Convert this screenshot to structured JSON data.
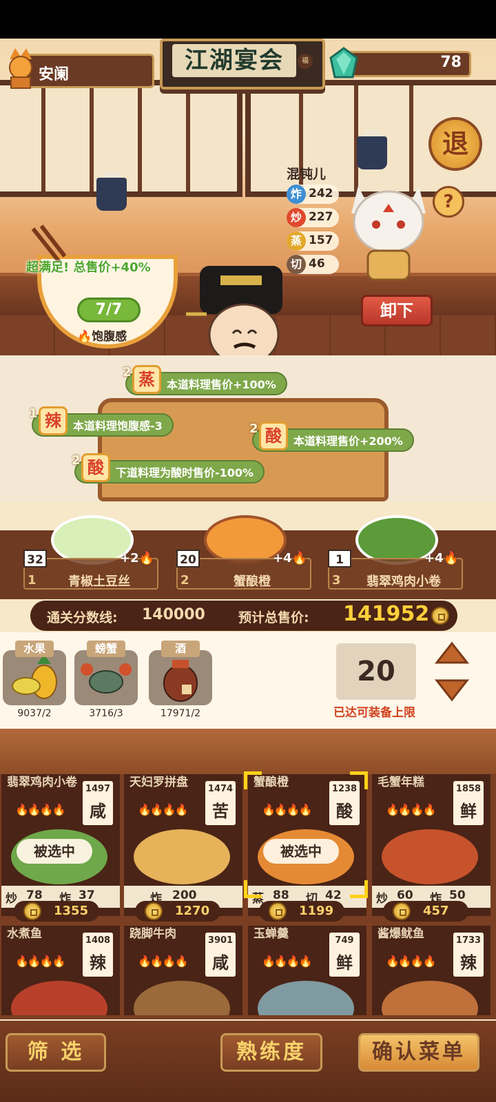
{
  "header": {
    "player_name": "安阑",
    "title": "江湖宴会",
    "title_tag": "福",
    "gems": "78",
    "exit_label": "退",
    "help_label": "?"
  },
  "chef": {
    "name": "混钝儿",
    "stats": [
      {
        "key": "炸",
        "value": "242",
        "color": "#3f8fd2"
      },
      {
        "key": "炒",
        "value": "227",
        "color": "#e0492e"
      },
      {
        "key": "蒸",
        "value": "157",
        "color": "#e2a82a"
      },
      {
        "key": "切",
        "value": "46",
        "color": "#7a5a44"
      }
    ]
  },
  "satisfaction": {
    "message": "超满足!  总售价+40%",
    "fill": "7/7",
    "fill_label": "饱腹感"
  },
  "unload_label": "卸下",
  "buffs": [
    {
      "count": "2",
      "tag": "蒸",
      "text": "本道料理售价+100%"
    },
    {
      "count": "1",
      "tag": "辣",
      "text": "本道料理饱腹感-3"
    },
    {
      "count": "2",
      "tag": "酸",
      "text": "本道料理售价+200%"
    },
    {
      "count": "2",
      "tag": "酸",
      "text": "下道料理为酸时售价-100%"
    }
  ],
  "slots": [
    {
      "qty": "32",
      "index": "1",
      "name": "青椒土豆丝",
      "bonus": "+2",
      "plate": "#d9efb8"
    },
    {
      "qty": "20",
      "index": "2",
      "name": "蟹酿橙",
      "bonus": "+4",
      "plate": "#f29a3a"
    },
    {
      "qty": "1",
      "index": "3",
      "name": "翡翠鸡肉小卷",
      "bonus": "+4",
      "plate": "#5c9a3a"
    }
  ],
  "score": {
    "threshold_label": "通关分数线:",
    "threshold_value": "140000",
    "estimate_label": "预计总售价:",
    "estimate_value": "141952"
  },
  "ingredients": [
    {
      "label": "水果",
      "count": "9037/2"
    },
    {
      "label": "螃蟹",
      "count": "3716/3"
    },
    {
      "label": "酒",
      "count": "17971/2"
    }
  ],
  "equip_count": "20",
  "equip_note": "已达可装备上限",
  "dishes": [
    {
      "name": "翡翠鸡肉小卷",
      "price": "1497",
      "taste": "咸",
      "flames": "🔥🔥🔥🔥",
      "skills": [
        {
          "k": "炒",
          "v": "78"
        },
        {
          "k": "炸",
          "v": "37"
        }
      ],
      "cost": "1355",
      "selected": true,
      "selected_label": "被选中",
      "food": "#6ea84a"
    },
    {
      "name": "天妇罗拼盘",
      "price": "1474",
      "taste": "苦",
      "flames": "🔥🔥🔥🔥",
      "skills": [
        {
          "k": "炸",
          "v": "200"
        }
      ],
      "cost": "1270",
      "selected": false,
      "food": "#e6b25a"
    },
    {
      "name": "蟹酿橙",
      "price": "1238",
      "taste": "酸",
      "flames": "🔥🔥🔥🔥",
      "skills": [
        {
          "k": "蒸",
          "v": "88"
        },
        {
          "k": "切",
          "v": "42"
        }
      ],
      "cost": "1199",
      "selected": true,
      "selected_label": "被选中",
      "food": "#e58a34"
    },
    {
      "name": "毛蟹年糕",
      "price": "1858",
      "taste": "鲜",
      "flames": "🔥🔥🔥🔥",
      "skills": [
        {
          "k": "炒",
          "v": "60"
        },
        {
          "k": "炸",
          "v": "50"
        }
      ],
      "cost": "457",
      "selected": false,
      "food": "#c6532c"
    },
    {
      "name": "水煮鱼",
      "price": "1408",
      "taste": "辣",
      "flames": "🔥🔥🔥🔥",
      "food": "#b8402a"
    },
    {
      "name": "跷脚牛肉",
      "price": "3901",
      "taste": "咸",
      "flames": "🔥🔥🔥🔥",
      "food": "#9a6a3a"
    },
    {
      "name": "玉蝉羹",
      "price": "749",
      "taste": "鲜",
      "flames": "🔥🔥🔥🔥",
      "food": "#7f9aa0"
    },
    {
      "name": "酱爆鱿鱼",
      "price": "1733",
      "taste": "辣",
      "flames": "🔥🔥🔥🔥",
      "food": "#c0703a"
    }
  ],
  "bottom": {
    "filter_label": "筛 选",
    "skill_label": "熟练度",
    "confirm_label": "确认菜单"
  }
}
